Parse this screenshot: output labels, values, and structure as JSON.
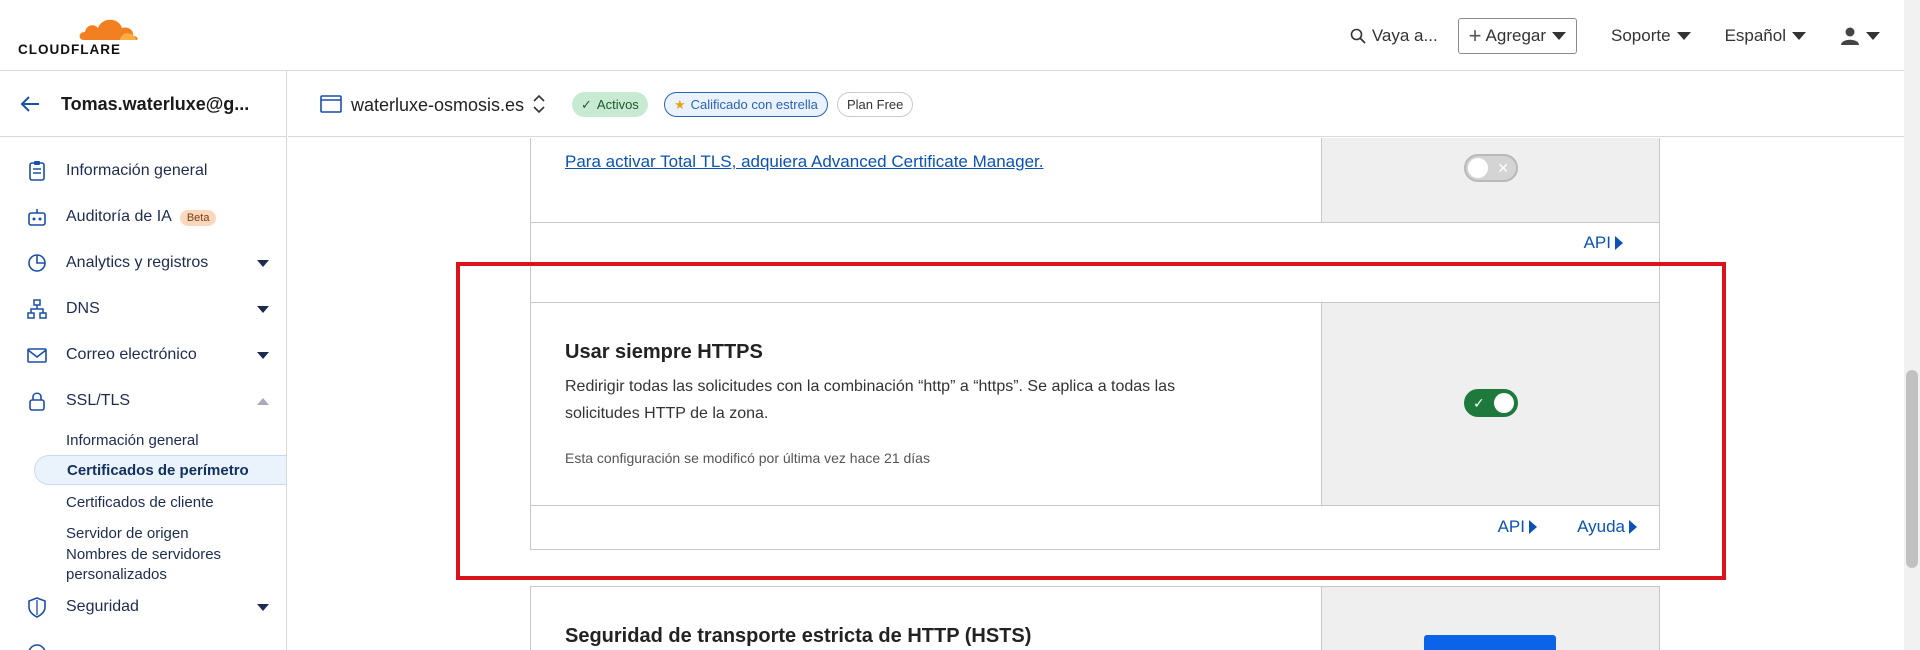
{
  "header": {
    "logo_text": "CLOUDFLARE",
    "search_label": "Vaya a...",
    "add_label": "Agregar",
    "support_label": "Soporte",
    "language_label": "Español",
    "brand_color": "#f38020"
  },
  "sidebar": {
    "account_name": "Tomas.waterluxe@g...",
    "items": [
      {
        "label": "Información general",
        "icon": "clipboard-icon"
      },
      {
        "label": "Auditoría de IA",
        "badge": "Beta",
        "icon": "robot-icon"
      },
      {
        "label": "Analytics y registros",
        "icon": "pie-chart-icon"
      },
      {
        "label": "DNS",
        "icon": "network-icon"
      },
      {
        "label": "Correo electrónico",
        "icon": "mail-icon"
      },
      {
        "label": "SSL/TLS",
        "icon": "lock-icon"
      }
    ],
    "ssl_sub": [
      "Información general",
      "Certificados de perímetro",
      "Certificados de cliente",
      "Servidor de origen",
      "Nombres de servidores personalizados"
    ],
    "security_label": "Seguridad"
  },
  "zone": {
    "name": "waterluxe-osmosis.es",
    "status_badge": "Activos",
    "star_badge": "Calificado con estrella",
    "plan_badge": "Plan Free"
  },
  "cards": {
    "tls_link": "Para activar Total TLS, adquiera Advanced Certificate Manager.",
    "tls_api": "API",
    "https": {
      "title": "Usar siempre HTTPS",
      "description": "Redirigir todas las solicitudes con la combinación “http” a “https”. Se aplica a todas las solicitudes HTTP de la zona.",
      "note": "Esta configuración se modificó por última vez hace 21 días",
      "api": "API",
      "help": "Ayuda",
      "enabled": true
    },
    "hsts": {
      "title": "Seguridad de transporte estricta de HTTP (HSTS)"
    }
  }
}
